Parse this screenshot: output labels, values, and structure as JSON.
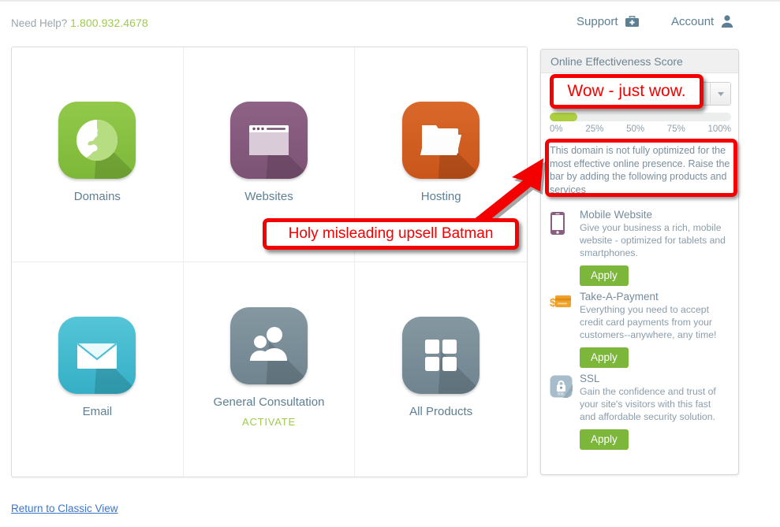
{
  "topbar": {
    "need_help_label": "Need Help?",
    "phone": "1.800.932.4678",
    "support_label": "Support",
    "support_icon": "first-aid-kit-icon",
    "account_label": "Account",
    "account_icon": "user-silhouette-icon"
  },
  "tiles": [
    {
      "label": "Domains",
      "icon": "globe-icon",
      "color": "#8cc63f",
      "sub": ""
    },
    {
      "label": "Websites",
      "icon": "browser-window-icon",
      "color": "#8a5e81",
      "sub": ""
    },
    {
      "label": "Hosting",
      "icon": "folder-icon",
      "color": "#d2601c",
      "sub": ""
    },
    {
      "label": "Email",
      "icon": "envelope-icon",
      "color": "#4bbdd4",
      "sub": ""
    },
    {
      "label": "General Consultation",
      "icon": "two-people-icon",
      "color": "#7e929c",
      "sub": "ACTIVATE"
    },
    {
      "label": "All Products",
      "icon": "grid-squares-icon",
      "color": "#7e929c",
      "sub": ""
    }
  ],
  "sidebar": {
    "header": "Online Effectiveness Score",
    "domain_select_value": "",
    "score_percent": 15,
    "score_fill_color": "#adcf3f",
    "ticks": [
      "0%",
      "25%",
      "50%",
      "75%",
      "100%"
    ],
    "message": "This domain is not fully optimized for the most effective online presence. Raise the bar by adding the following products and services",
    "products": [
      {
        "name": "Mobile Website",
        "icon": "mobile-phone-icon",
        "description": "Give your business a rich, mobile website - optimized for tablets and smartphones.",
        "button_label": "Apply"
      },
      {
        "name": "Take-A-Payment",
        "icon": "credit-card-dollar-icon",
        "description": "Everything you need to accept credit card payments from your customers--anywhere, any time!",
        "button_label": "Apply"
      },
      {
        "name": "SSL",
        "icon": "padlock-ssl-icon",
        "description": "Gain the confidence and trust of your site's visitors with this fast and affordable security solution.",
        "button_label": "Apply"
      }
    ]
  },
  "footer": {
    "classic_view_link": "Return to Classic View"
  },
  "annotations": {
    "color": "#f50000",
    "wow": "Wow - just wow.",
    "batman": "Holy misleading upsell Batman",
    "arrow": "red-arrow-annotation",
    "message_highlight": "message-box-highlight"
  }
}
